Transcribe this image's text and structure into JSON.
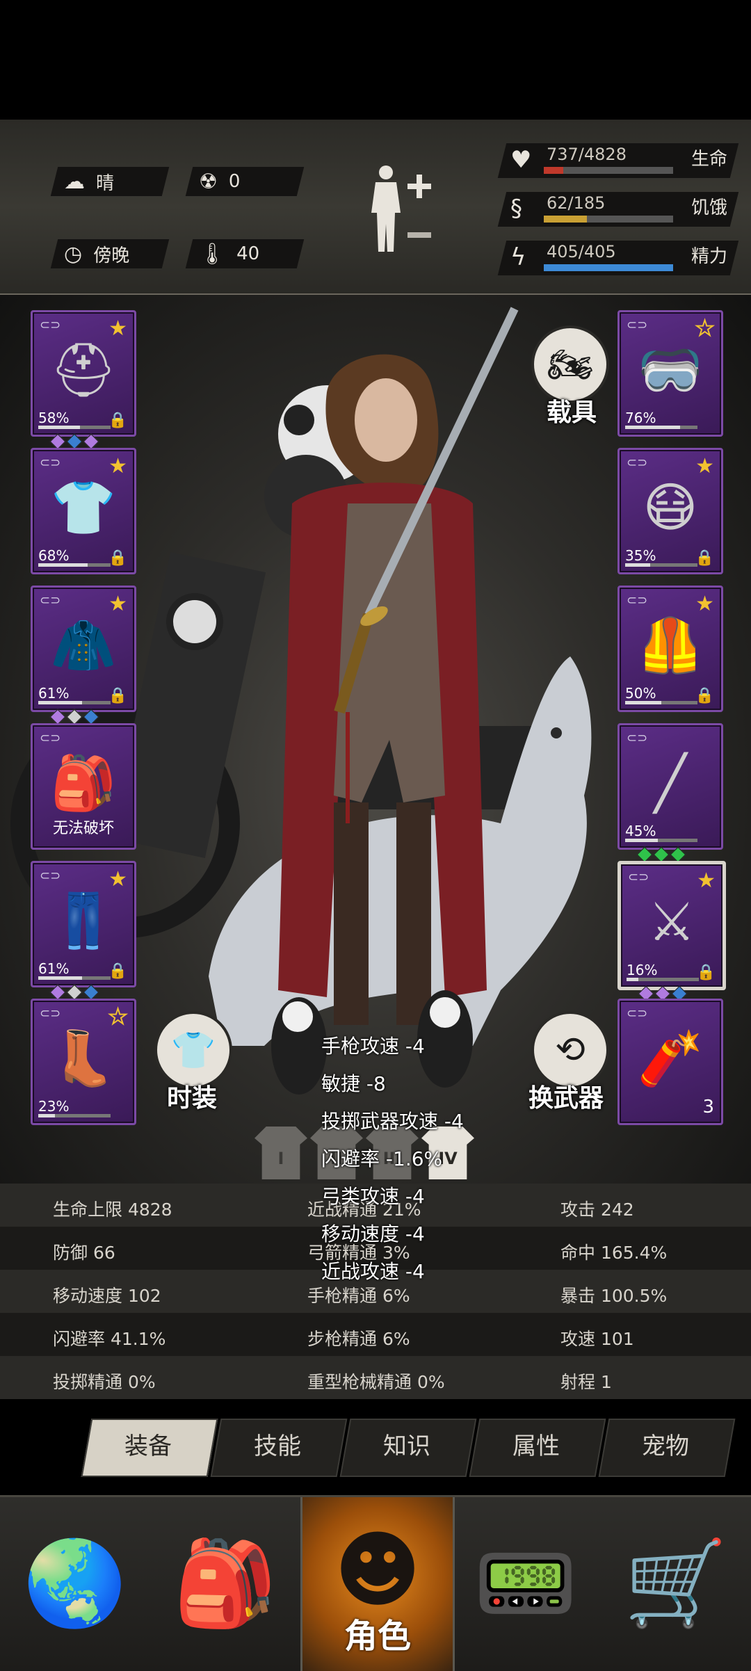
{
  "header": {
    "weather": {
      "icon": "cloud-sun-icon",
      "label": "晴"
    },
    "radiation": {
      "icon": "radiation-icon",
      "value": "0"
    },
    "time": {
      "icon": "clock-icon",
      "label": "傍晚"
    },
    "temperature": {
      "icon": "thermometer-icon",
      "value": "40"
    },
    "body_button_icon": "body-plus-minus-icon",
    "vitals": [
      {
        "name": "生命",
        "value": "737/4828",
        "fraction": 0.153,
        "color": "#c0392b",
        "icon": "heart-icon"
      },
      {
        "name": "饥饿",
        "value": "62/185",
        "fraction": 0.335,
        "color": "#c9a034",
        "icon": "stomach-icon"
      },
      {
        "name": "精力",
        "value": "405/405",
        "fraction": 1.0,
        "color": "#3d8ad6",
        "icon": "energy-head-icon"
      }
    ]
  },
  "equipment_left": [
    {
      "name": "helmet",
      "icon": "helmet-icon",
      "durability": "58%",
      "fraction": 0.58,
      "star": "filled",
      "locked": true,
      "gems": [
        "#b07be0",
        "#3a7fd0",
        "#b07be0"
      ]
    },
    {
      "name": "shirt",
      "icon": "shirt-icon",
      "durability": "68%",
      "fraction": 0.68,
      "star": "filled",
      "locked": true,
      "gems": []
    },
    {
      "name": "jacket",
      "icon": "jacket-icon",
      "durability": "61%",
      "fraction": 0.61,
      "star": "filled",
      "locked": true,
      "gems": [
        "#b07be0",
        "#d0d0d0",
        "#3a7fd0"
      ]
    },
    {
      "name": "backpack",
      "icon": "backpack-icon",
      "status": "无法破坏",
      "star": "",
      "locked": false,
      "gems": []
    },
    {
      "name": "pants",
      "icon": "pants-icon",
      "durability": "61%",
      "fraction": 0.61,
      "star": "filled",
      "locked": true,
      "gems": [
        "#b07be0",
        "#d0d0d0",
        "#3a7fd0"
      ]
    },
    {
      "name": "boots",
      "icon": "boots-icon",
      "durability": "23%",
      "fraction": 0.23,
      "star": "outline",
      "locked": false,
      "gems": []
    }
  ],
  "equipment_right": [
    {
      "name": "goggles",
      "icon": "goggles-icon",
      "durability": "76%",
      "fraction": 0.76,
      "star": "outline",
      "locked": false,
      "gems": []
    },
    {
      "name": "gas-mask",
      "icon": "gas-mask-icon",
      "durability": "35%",
      "fraction": 0.35,
      "star": "filled",
      "locked": true,
      "gems": []
    },
    {
      "name": "vest",
      "icon": "vest-icon",
      "durability": "50%",
      "fraction": 0.5,
      "star": "filled",
      "locked": true,
      "gems": []
    },
    {
      "name": "rifle",
      "icon": "rifle-icon",
      "durability": "45%",
      "fraction": 0.45,
      "star": "",
      "locked": false,
      "gems": [
        "#2fc24a",
        "#2fc24a",
        "#2fc24a"
      ]
    },
    {
      "name": "katana",
      "icon": "katana-icon",
      "durability": "16%",
      "fraction": 0.16,
      "star": "filled",
      "locked": true,
      "gems": [
        "#b07be0",
        "#b07be0",
        "#3a7fd0"
      ],
      "selected": true
    },
    {
      "name": "dynamite",
      "icon": "dynamite-icon",
      "count": "3",
      "star": "",
      "locked": false,
      "gems": []
    }
  ],
  "scene": {
    "vehicle_label": "载具",
    "vehicle_icon": "motorcycle-icon",
    "fashion_label": "时装",
    "fashion_icon": "tshirt-icon",
    "swap_label": "换武器",
    "swap_icon": "swap-arrows-icon",
    "outfit_presets": [
      "I",
      "II",
      "III",
      "IV"
    ]
  },
  "tooltip": [
    "手枪攻速 -4",
    "敏捷 -8",
    "投掷武器攻速 -4",
    "闪避率 -1.6%",
    "弓类攻速 -4",
    "移动速度 -4",
    "近战攻速 -4"
  ],
  "stats": [
    [
      "生命上限 4828",
      "近战精通 21%",
      "攻击 242"
    ],
    [
      "防御 66",
      "弓箭精通 3%",
      "命中 165.4%"
    ],
    [
      "移动速度 102",
      "手枪精通 6%",
      "暴击 100.5%"
    ],
    [
      "闪避率 41.1%",
      "步枪精通 6%",
      "攻速 101"
    ],
    [
      "投掷精通 0%",
      "重型枪械精通 0%",
      "射程 1"
    ]
  ],
  "tabs": [
    "装备",
    "技能",
    "知识",
    "属性",
    "宠物"
  ],
  "nav": [
    {
      "icon": "globe-icon",
      "label": ""
    },
    {
      "icon": "backpack-icon",
      "label": ""
    },
    {
      "icon": "character-head-icon",
      "label": "角色"
    },
    {
      "icon": "radio-icon",
      "label": ""
    },
    {
      "icon": "cart-icon",
      "label": ""
    }
  ]
}
